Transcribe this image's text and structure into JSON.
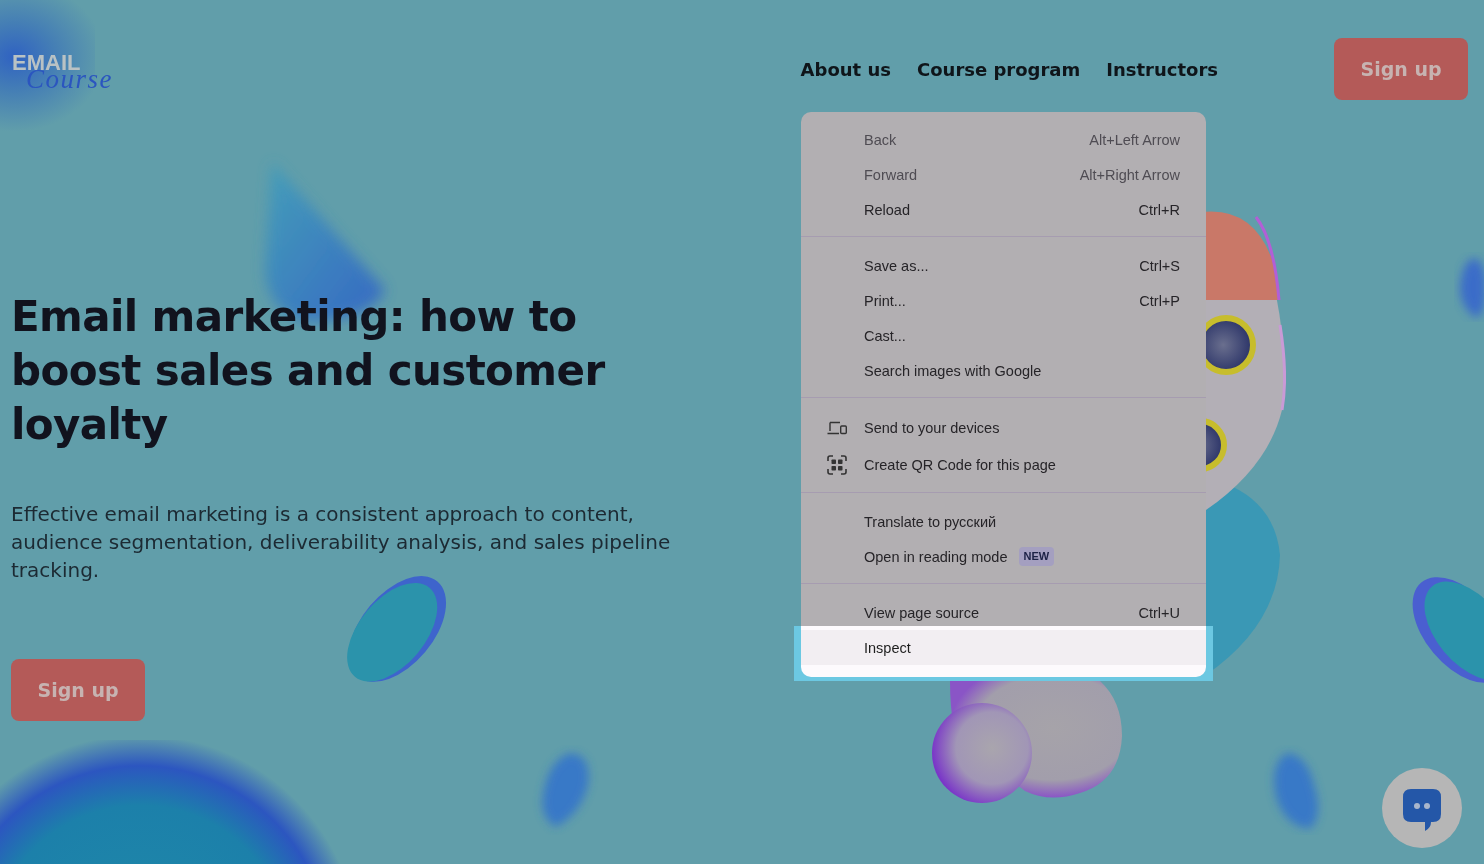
{
  "header": {
    "logo": {
      "word": "EMAIL",
      "script": "Course"
    },
    "nav": [
      {
        "label": "About us"
      },
      {
        "label": "Course program"
      },
      {
        "label": "Instructors"
      }
    ],
    "button": "Sign up"
  },
  "hero": {
    "title": "Email marketing: how to boost sales and customer loyalty",
    "description": "Effective email marketing is a consistent approach to content, audience segmentation, deliverability analysis, and sales pipeline tracking.",
    "button": "Sign up"
  },
  "context_menu": {
    "groups": [
      {
        "items": [
          {
            "kind": "plain",
            "label": "Back",
            "shortcut": "Alt+Left Arrow",
            "disabled": true,
            "selected": false
          },
          {
            "kind": "plain",
            "label": "Forward",
            "shortcut": "Alt+Right Arrow",
            "disabled": true,
            "selected": false
          },
          {
            "kind": "plain",
            "label": "Reload",
            "shortcut": "Ctrl+R",
            "disabled": false,
            "selected": false
          }
        ]
      },
      {
        "items": [
          {
            "kind": "plain",
            "label": "Save as...",
            "shortcut": "Ctrl+S",
            "disabled": false,
            "selected": false
          },
          {
            "kind": "plain",
            "label": "Print...",
            "shortcut": "Ctrl+P",
            "disabled": false,
            "selected": false
          },
          {
            "kind": "plain",
            "label": "Cast...",
            "disabled": false,
            "selected": false
          },
          {
            "kind": "plain",
            "label": "Search images with Google",
            "disabled": false,
            "selected": false
          }
        ]
      },
      {
        "items": [
          {
            "kind": "devices",
            "label": "Send to your devices",
            "disabled": false,
            "selected": false
          },
          {
            "kind": "qr",
            "label": "Create QR Code for this page",
            "disabled": false,
            "selected": false
          }
        ]
      },
      {
        "items": [
          {
            "kind": "plain",
            "label": "Translate to русский",
            "disabled": false,
            "selected": false
          },
          {
            "kind": "plain",
            "label": "Open in reading mode",
            "badge": "NEW",
            "disabled": false,
            "selected": false
          }
        ]
      },
      {
        "items": [
          {
            "kind": "plain",
            "label": "View page source",
            "shortcut": "Ctrl+U",
            "disabled": false,
            "selected": false
          },
          {
            "kind": "plain",
            "label": "Inspect",
            "disabled": false,
            "selected": true
          }
        ]
      }
    ]
  }
}
